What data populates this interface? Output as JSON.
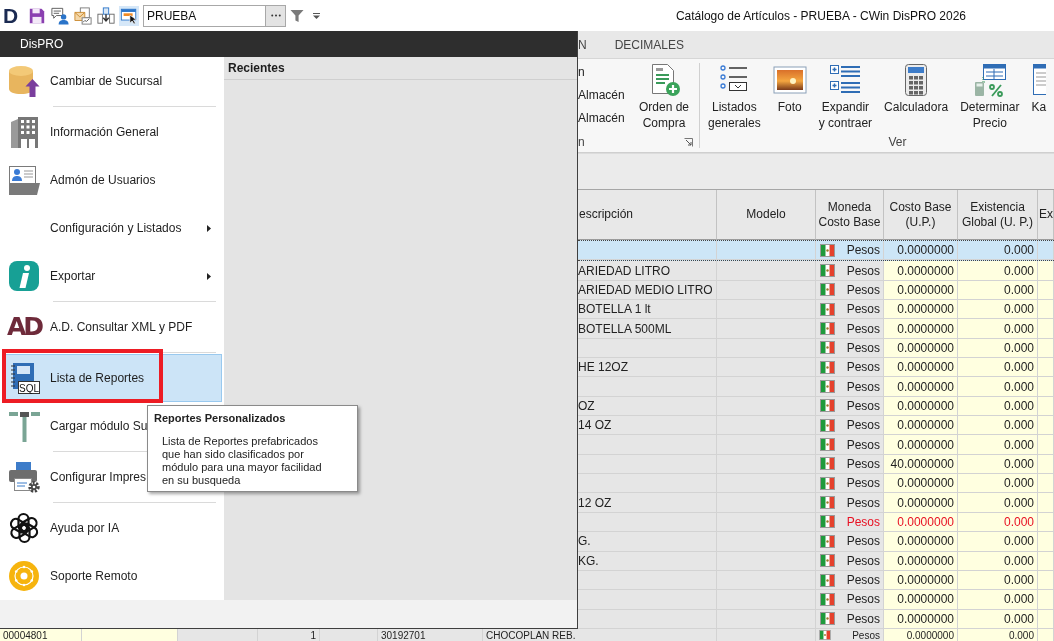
{
  "app_logo": "D",
  "quick_access": {
    "buttons": [
      {
        "highlighted": false
      },
      {
        "highlighted": false
      },
      {
        "highlighted": false
      },
      {
        "highlighted": false
      },
      {
        "highlighted": true
      }
    ],
    "field": {
      "value": "PRUEBA"
    }
  },
  "window": {
    "title": "Catálogo de Artículos - PRUEBA - CWin DisPRO 2026"
  },
  "backstage_menu": {
    "title": "DisPRO",
    "groups": [
      {
        "items": [
          {
            "label": "Cambiar de Sucursal",
            "submenu": false,
            "selected": false,
            "annotated": false
          }
        ]
      },
      {
        "items": [
          {
            "label": "Información General",
            "submenu": false,
            "selected": false,
            "annotated": false
          },
          {
            "label": "Admón de Usuarios",
            "submenu": false,
            "selected": false,
            "annotated": false
          },
          {
            "label": "Configuración y Listados",
            "submenu": true,
            "selected": false,
            "annotated": false
          },
          {
            "label": "Exportar",
            "submenu": true,
            "selected": false,
            "annotated": false
          }
        ]
      },
      {
        "items": [
          {
            "label": "A.D. Consultar XML y PDF",
            "icon_text": "AD",
            "submenu": false,
            "selected": false,
            "annotated": false
          }
        ]
      },
      {
        "items": [
          {
            "label": "Lista de Reportes",
            "icon_text": "SQL",
            "submenu": false,
            "selected": true,
            "annotated": true
          },
          {
            "label": "Cargar módulo Su",
            "submenu": false,
            "selected": false,
            "annotated": false
          }
        ]
      },
      {
        "items": [
          {
            "label": "Configurar Impres",
            "submenu": false,
            "selected": false,
            "annotated": false
          }
        ]
      },
      {
        "items": [
          {
            "label": "Ayuda por IA",
            "submenu": false,
            "selected": false,
            "annotated": false
          },
          {
            "label": "Soporte Remoto",
            "submenu": false,
            "selected": false,
            "annotated": false
          }
        ]
      }
    ],
    "recent": {
      "title": "Recientes"
    },
    "tooltip": {
      "title": "Reportes Personalizados",
      "text": "Lista de Reportes prefabricados que han sido clasificados por módulo para una mayor facilidad en su busqueda"
    }
  },
  "ribbon": {
    "tabs": [
      {
        "label": "N",
        "selected": false
      },
      {
        "label": "DECIMALES",
        "selected": false
      }
    ],
    "groups": [
      {
        "label": "n",
        "small_buttons": [
          "n",
          "Almacén",
          "Almacén"
        ],
        "large_buttons": [
          "Orden de\nCompra"
        ],
        "launcher": true
      },
      {
        "label": "Ver",
        "large_buttons": [
          "Listados\ngenerales",
          "Foto",
          "Expandir\ny contraer",
          "Calculadora",
          "Determinar\nPrecio",
          "Ka"
        ]
      }
    ]
  },
  "table": {
    "columns": [
      "escripción",
      "Modelo",
      "Moneda Costo Base",
      "Costo Base (U.P.)",
      "Existencia Global (U. P.)",
      "Ex"
    ],
    "rows": [
      {
        "currency": "Pesos",
        "cost": "0.0000000",
        "stock": "0.000",
        "selected": true,
        "alert": false
      },
      {
        "description": "ARIEDAD LITRO",
        "currency": "Pesos",
        "cost": "0.0000000",
        "stock": "0.000",
        "selected": false,
        "alert": false
      },
      {
        "description": "ARIEDAD MEDIO LITRO",
        "currency": "Pesos",
        "cost": "0.0000000",
        "stock": "0.000",
        "selected": false,
        "alert": false
      },
      {
        "description": "BOTELLA 1 lt",
        "currency": "Pesos",
        "cost": "0.0000000",
        "stock": "0.000",
        "selected": false,
        "alert": false
      },
      {
        "description": "BOTELLA 500ML",
        "currency": "Pesos",
        "cost": "0.0000000",
        "stock": "0.000",
        "selected": false,
        "alert": false
      },
      {
        "currency": "Pesos",
        "cost": "0.0000000",
        "stock": "0.000",
        "selected": false,
        "alert": false
      },
      {
        "description": "HE 12OZ",
        "currency": "Pesos",
        "cost": "0.0000000",
        "stock": "0.000",
        "selected": false,
        "alert": false
      },
      {
        "currency": "Pesos",
        "cost": "0.0000000",
        "stock": "0.000",
        "selected": false,
        "alert": false
      },
      {
        "description": "OZ",
        "currency": "Pesos",
        "cost": "0.0000000",
        "stock": "0.000",
        "selected": false,
        "alert": false
      },
      {
        "description": "14 OZ",
        "currency": "Pesos",
        "cost": "0.0000000",
        "stock": "0.000",
        "selected": false,
        "alert": false
      },
      {
        "currency": "Pesos",
        "cost": "0.0000000",
        "stock": "0.000",
        "selected": false,
        "alert": false
      },
      {
        "currency": "Pesos",
        "cost": "40.0000000",
        "stock": "0.000",
        "selected": false,
        "alert": false
      },
      {
        "currency": "Pesos",
        "cost": "0.0000000",
        "stock": "0.000",
        "selected": false,
        "alert": false
      },
      {
        "description": "12 OZ",
        "currency": "Pesos",
        "cost": "0.0000000",
        "stock": "0.000",
        "selected": false,
        "alert": false
      },
      {
        "currency": "Pesos",
        "cost": "0.0000000",
        "stock": "0.000",
        "selected": false,
        "alert": true
      },
      {
        "description": "G.",
        "currency": "Pesos",
        "cost": "0.0000000",
        "stock": "0.000",
        "selected": false,
        "alert": false
      },
      {
        "description": "KG.",
        "currency": "Pesos",
        "cost": "0.0000000",
        "stock": "0.000",
        "selected": false,
        "alert": false
      },
      {
        "currency": "Pesos",
        "cost": "0.0000000",
        "stock": "0.000",
        "selected": false,
        "alert": false
      },
      {
        "currency": "Pesos",
        "cost": "0.0000000",
        "stock": "0.000",
        "selected": false,
        "alert": false
      },
      {
        "currency": "Pesos",
        "cost": "0.0000000",
        "stock": "0.000",
        "selected": false,
        "alert": false
      }
    ]
  },
  "bottom_row": {
    "code": "00004801",
    "quantity": "1",
    "barcode": "30192701",
    "description": "CHOCOPLAN REB.",
    "currency": "Pesos",
    "cost": "0.0000000",
    "stock": "0.000"
  }
}
